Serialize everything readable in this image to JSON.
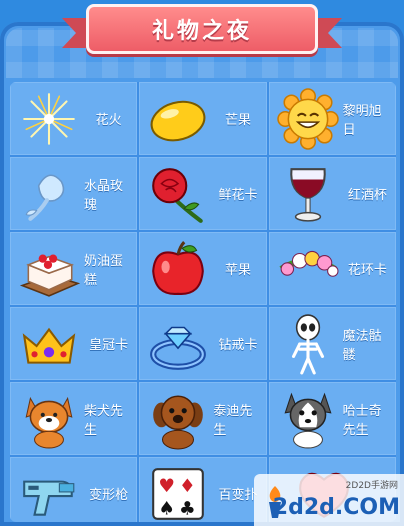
{
  "header": {
    "title": "礼物之夜"
  },
  "gifts": [
    {
      "label": "花火",
      "icon": "firework-icon"
    },
    {
      "label": "芒果",
      "icon": "mango-icon"
    },
    {
      "label": "黎明旭日",
      "icon": "sun-icon"
    },
    {
      "label": "水晶玫瑰",
      "icon": "crystal-rose-icon"
    },
    {
      "label": "鲜花卡",
      "icon": "rose-icon"
    },
    {
      "label": "红酒杯",
      "icon": "wine-glass-icon"
    },
    {
      "label": "奶油蛋糕",
      "icon": "cake-icon"
    },
    {
      "label": "苹果",
      "icon": "apple-icon"
    },
    {
      "label": "花环卡",
      "icon": "flower-wreath-icon"
    },
    {
      "label": "皇冠卡",
      "icon": "crown-icon"
    },
    {
      "label": "钻戒卡",
      "icon": "diamond-ring-icon"
    },
    {
      "label": "魔法骷髅",
      "icon": "skeleton-icon"
    },
    {
      "label": "柴犬先生",
      "icon": "shiba-dog-icon"
    },
    {
      "label": "泰迪先生",
      "icon": "teddy-dog-icon"
    },
    {
      "label": "哈士奇先生",
      "icon": "husky-dog-icon"
    },
    {
      "label": "变形枪",
      "icon": "toy-gun-icon"
    },
    {
      "label": "百变扑",
      "icon": "playing-cards-icon"
    },
    {
      "label": "",
      "icon": "heart-icon"
    }
  ],
  "watermark": {
    "site_cn": "2D2D手游网",
    "site_en": "2d2d.COM"
  }
}
